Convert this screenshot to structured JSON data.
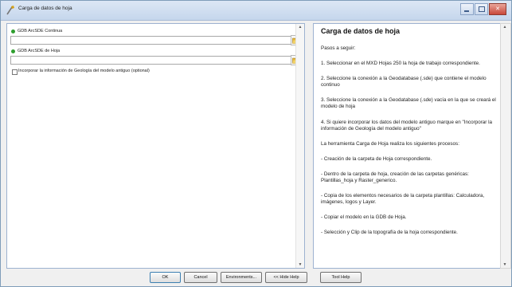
{
  "window": {
    "title": "Carga de datos de hoja",
    "controls": {
      "minimize": "minimize",
      "maximize": "maximize",
      "close": "✕"
    }
  },
  "params": {
    "gdb_continua": {
      "label": "GDB ArcSDE Continua",
      "value": ""
    },
    "gdb_hoja": {
      "label": "GDB ArcSDE de Hoja",
      "value": ""
    },
    "checkbox": {
      "label": "Incorporar la información de Geología del modelo antiguo (optional)",
      "checked": false
    }
  },
  "help": {
    "title": "Carga de datos de hoja",
    "paragraphs": [
      "Pasos a seguir:",
      "1. Seleccionar en el MXD Hojas 250 la hoja de trabajo correspondiente.",
      "2. Seleccione la conexión a la Geodatabase (.sde) que contiene el modelo continuo",
      "3. Seleccione la conexión a la Geodatabase (.sde) vacía en la que se creará el modelo de hoja",
      "4. Si quiere incorporar los datos del modelo antiguo marque en \"Incorporar la información de Geología del modelo antiguo\"",
      "La herramienta Carga de Hoja realiza los siguientes procesos:",
      "- Creación de la carpeta de Hoja correspondiente.",
      "- Dentro de la carpeta de hoja, creación de las carpetas genéricas: Plantillas_hoja y Raster_generico.",
      "- Copia de los elementos necesarios de la carpeta plantillas: Calculadora, imágenes, logos y Layer.",
      "- Copiar el modelo en la GDB de Hoja.",
      "- Selección y Clip de la topografía de la hoja correspondiente."
    ]
  },
  "buttons": {
    "ok": "OK",
    "cancel": "Cancel",
    "environments": "Environments...",
    "hide_help": "<< Hide Help",
    "tool_help": "Tool Help"
  },
  "colors": {
    "required_dot": "#2f9e2f",
    "title_bar": "#c5d6ec",
    "close_button": "#c8473a"
  }
}
